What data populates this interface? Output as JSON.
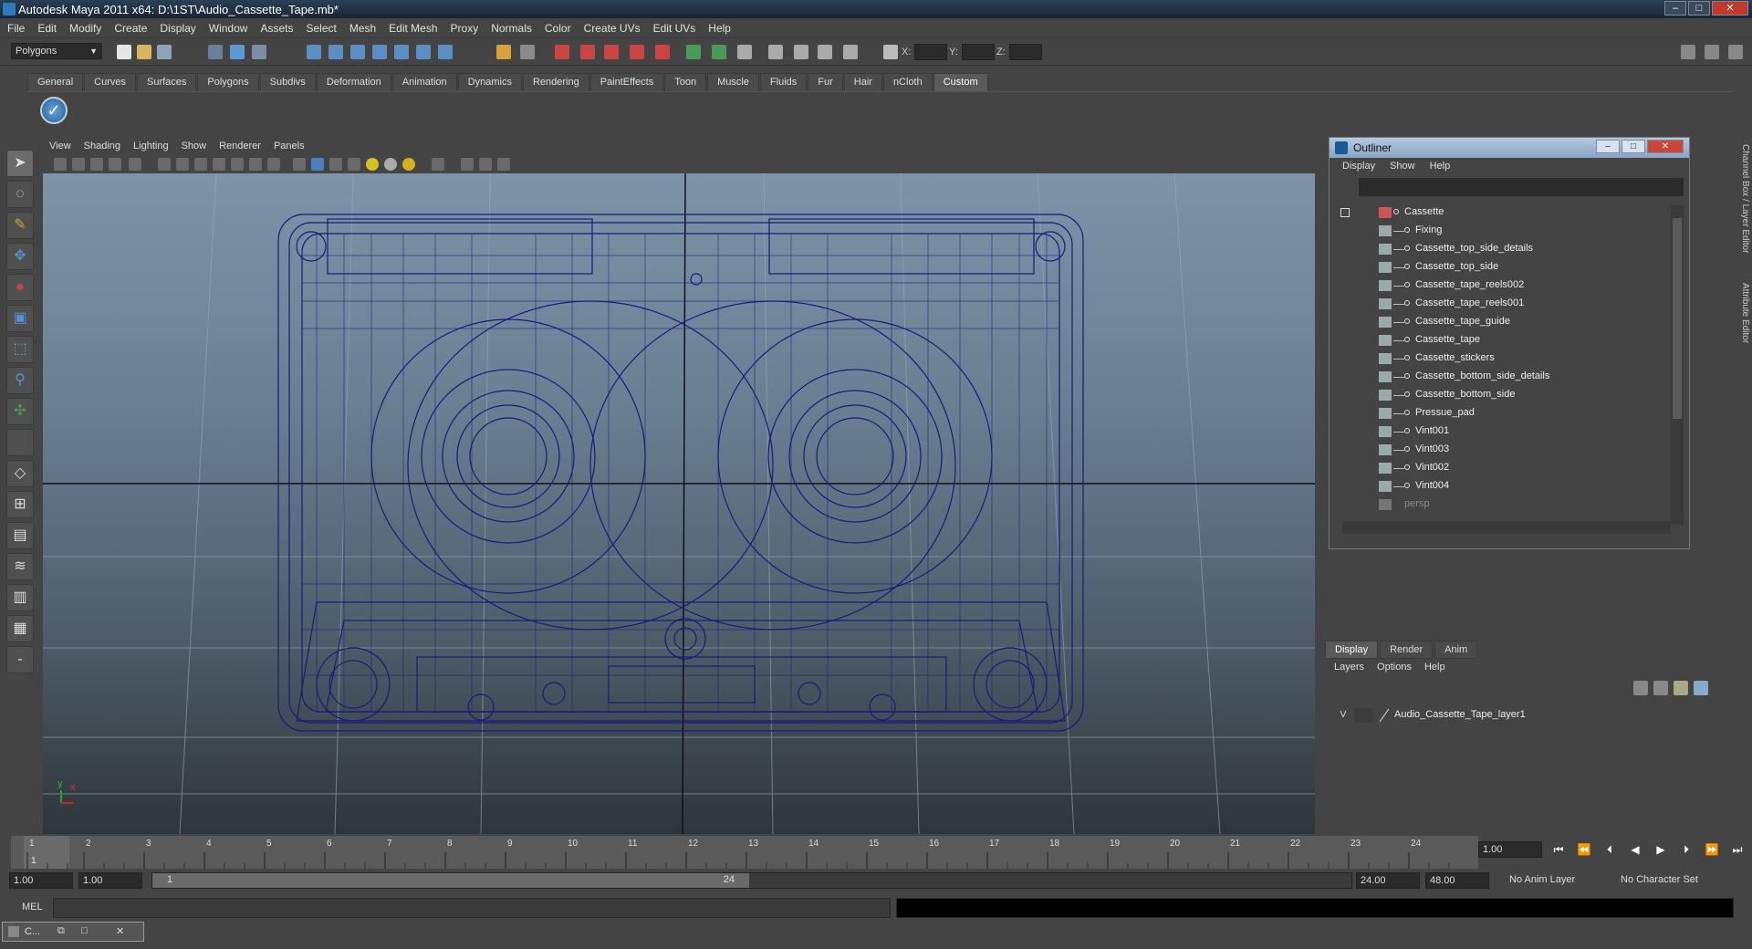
{
  "window": {
    "title": "Autodesk Maya 2011 x64: D:\\1ST\\Audio_Cassette_Tape.mb*",
    "buttons": [
      "–",
      "□",
      "✕"
    ]
  },
  "menubar": [
    "File",
    "Edit",
    "Modify",
    "Create",
    "Display",
    "Window",
    "Assets",
    "Select",
    "Mesh",
    "Edit Mesh",
    "Proxy",
    "Normals",
    "Color",
    "Create UVs",
    "Edit UVs",
    "Help"
  ],
  "statusline": {
    "mode": "Polygons",
    "x_label": "X:",
    "y_label": "Y:",
    "z_label": "Z:"
  },
  "shelf_tabs": [
    "General",
    "Curves",
    "Surfaces",
    "Polygons",
    "Subdivs",
    "Deformation",
    "Animation",
    "Dynamics",
    "Rendering",
    "PaintEffects",
    "Toon",
    "Muscle",
    "Fluids",
    "Fur",
    "Hair",
    "nCloth",
    "Custom"
  ],
  "shelf_active_tab": "Custom",
  "panel_menu": [
    "View",
    "Shading",
    "Lighting",
    "Show",
    "Renderer",
    "Panels"
  ],
  "viewport": {
    "axis_y": "y",
    "axis_x": "x",
    "wire_color": "#1a1a7a"
  },
  "outliner": {
    "title": "Outliner",
    "menu": [
      "Display",
      "Show",
      "Help"
    ],
    "root": "Cassette",
    "children": [
      "Fixing",
      "Cassette_top_side_details",
      "Cassette_top_side",
      "Cassette_tape_reels002",
      "Cassette_tape_reels001",
      "Cassette_tape_guide",
      "Cassette_tape",
      "Cassette_stickers",
      "Cassette_bottom_side_details",
      "Cassette_bottom_side",
      "Pressue_pad",
      "Vint001",
      "Vint003",
      "Vint002",
      "Vint004"
    ],
    "camera": "persp"
  },
  "side_tabs": [
    "Channel Box / Layer Editor",
    "Attribute Editor"
  ],
  "layers": {
    "tabs": [
      "Display",
      "Render",
      "Anim"
    ],
    "menu": [
      "Layers",
      "Options",
      "Help"
    ],
    "visible": "V",
    "layer_name": "Audio_Cassette_Tape_layer1"
  },
  "timeline": {
    "ticks": [
      "1",
      "2",
      "3",
      "4",
      "5",
      "6",
      "7",
      "8",
      "9",
      "10",
      "11",
      "12",
      "13",
      "14",
      "15",
      "16",
      "17",
      "18",
      "19",
      "20",
      "21",
      "22",
      "23",
      "24"
    ],
    "current_frame_marker": "1",
    "current_frame": "1.00"
  },
  "range": {
    "start": "1.00",
    "anim_start": "1.00",
    "handle_start": "1",
    "handle_end": "24",
    "end": "24.00",
    "anim_end": "48.00",
    "anim_layer": "No Anim Layer",
    "character_set": "No Character Set"
  },
  "cmdline": {
    "label": "MEL"
  },
  "minimized": {
    "title": "C..."
  }
}
